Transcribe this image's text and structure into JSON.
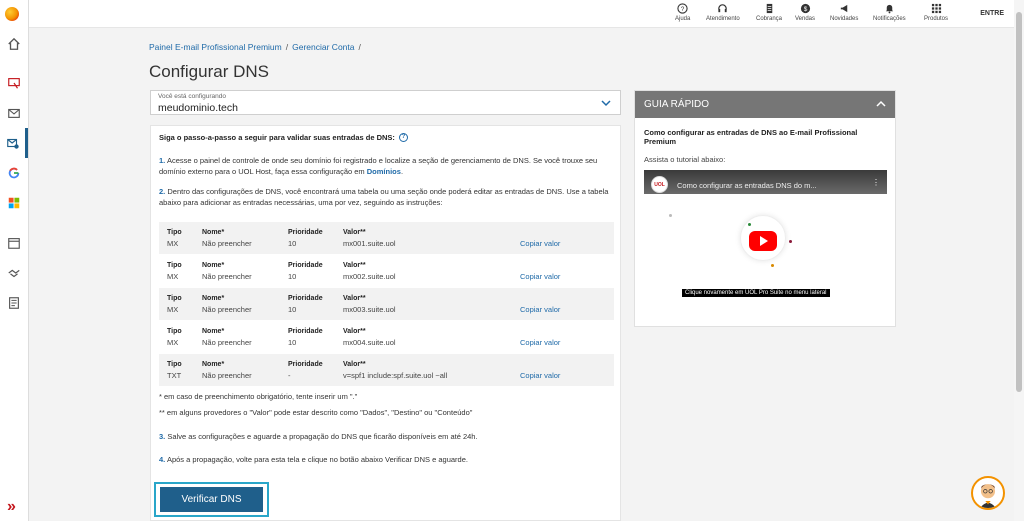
{
  "topbar": {
    "items": [
      {
        "label": "Ajuda",
        "icon": "help-icon"
      },
      {
        "label": "Atendimento",
        "icon": "headset-icon"
      },
      {
        "label": "Cobrança",
        "icon": "receipt-icon"
      },
      {
        "label": "Vendas",
        "icon": "dollar-icon"
      },
      {
        "label": "Novidades",
        "icon": "megaphone-icon"
      },
      {
        "label": "Notificações",
        "icon": "bell-icon"
      },
      {
        "label": "Produtos",
        "icon": "grid-icon"
      }
    ],
    "entre_label": "ENTRE"
  },
  "breadcrumb": {
    "item1": "Painel E-mail Profissional Premium",
    "item2": "Gerenciar Conta",
    "sep": "/"
  },
  "page_title": "Configurar DNS",
  "domain_select": {
    "label": "Você está configurando",
    "value": "meudominio.tech"
  },
  "instructions": {
    "intro": "Siga o passo-a-passo a seguir para validar suas entradas de DNS:",
    "step1_num": "1.",
    "step1_text": "Acesse o painel de controle de onde seu domínio foi registrado e localize a seção de gerenciamento de DNS. Se você trouxe seu domínio externo para o UOL Host, faça essa configuração em",
    "step1_link": "Domínios",
    "step1_end": ".",
    "step2_num": "2.",
    "step2_text": "Dentro das configurações de DNS, você encontrará uma tabela ou uma seção onde poderá editar as entradas de DNS. Use a tabela abaixo para adicionar as entradas necessárias, uma por vez, seguindo as instruções:",
    "note1": "* em caso de preenchimento obrigatório, tente inserir um \".\"",
    "note2": "** em alguns provedores o \"Valor\" pode estar descrito como \"Dados\", \"Destino\" ou \"Conteúdo\"",
    "step3_num": "3.",
    "step3_text": "Salve as configurações e aguarde a propagação do DNS que ficarão disponíveis em até 24h.",
    "step4_num": "4.",
    "step4_text": "Após a propagação, volte para esta tela e clique no botão abaixo Verificar DNS e aguarde."
  },
  "record_headers": {
    "tipo": "Tipo",
    "nome": "Nome*",
    "prioridade": "Prioridade",
    "valor": "Valor**"
  },
  "records": [
    {
      "tipo": "MX",
      "nome": "Não preencher",
      "prioridade": "10",
      "valor": "mx001.suite.uol",
      "copy": "Copiar valor"
    },
    {
      "tipo": "MX",
      "nome": "Não preencher",
      "prioridade": "10",
      "valor": "mx002.suite.uol",
      "copy": "Copiar valor"
    },
    {
      "tipo": "MX",
      "nome": "Não preencher",
      "prioridade": "10",
      "valor": "mx003.suite.uol",
      "copy": "Copiar valor"
    },
    {
      "tipo": "MX",
      "nome": "Não preencher",
      "prioridade": "10",
      "valor": "mx004.suite.uol",
      "copy": "Copiar valor"
    },
    {
      "tipo": "TXT",
      "nome": "Não preencher",
      "prioridade": "-",
      "valor": "v=spf1 include:spf.suite.uol ~all",
      "copy": "Copiar valor"
    }
  ],
  "verify_button": "Verificar DNS",
  "guide": {
    "header": "GUIA RÁPIDO",
    "title": "Como configurar as entradas de DNS ao E-mail Profissional Premium",
    "subtitle": "Assista o tutorial abaixo:",
    "video_title": "Como configurar as entradas DNS do m...",
    "video_channel": "UOL",
    "video_caption": "Clique novamente em UOL Pro Suite no menu lateral"
  },
  "colors": {
    "primary": "#1f5f8b",
    "link": "#1f6aa8",
    "accent": "#29a6c9",
    "guide_header": "#767676"
  }
}
